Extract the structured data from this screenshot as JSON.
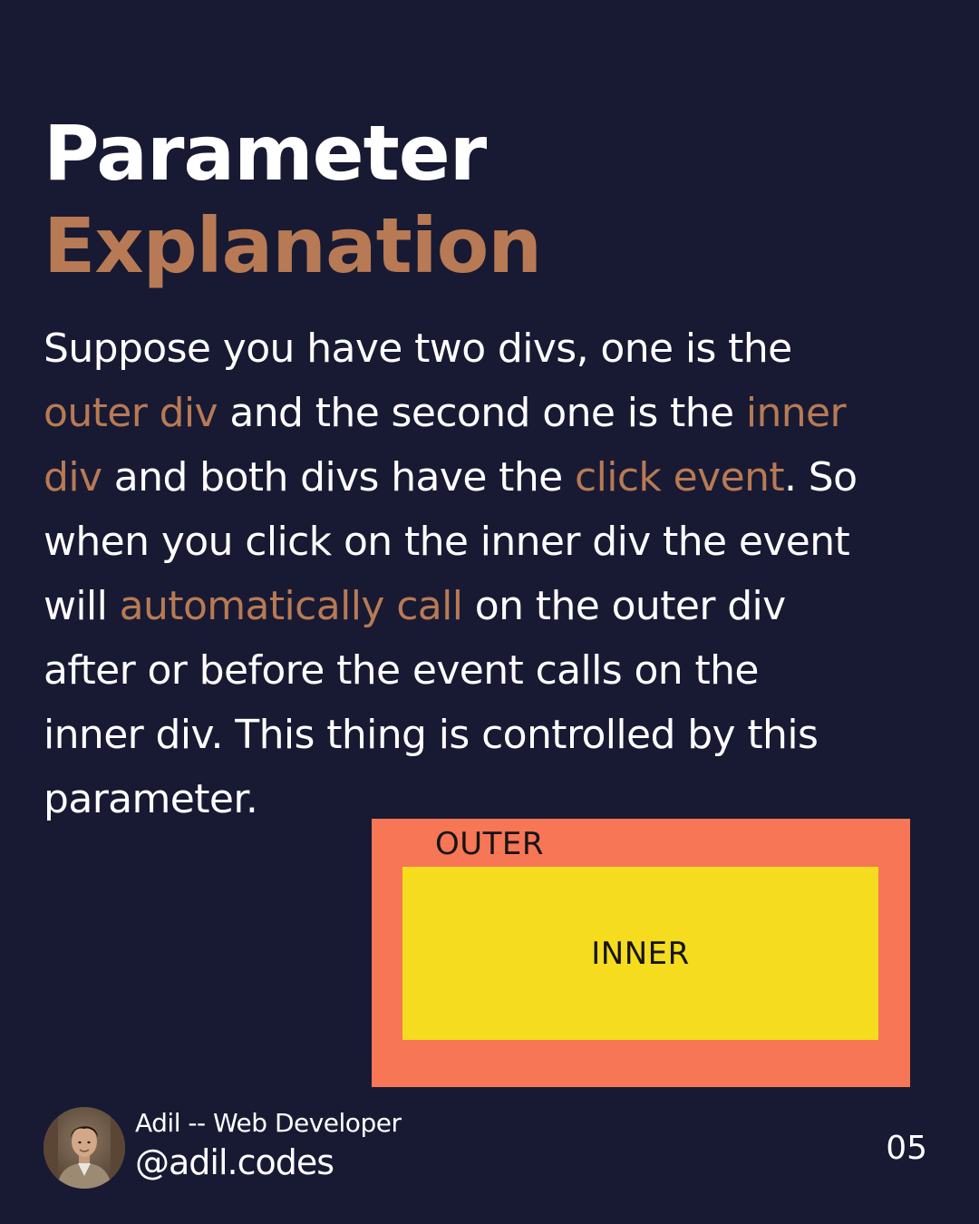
{
  "title": {
    "line1": "Parameter",
    "line2": "Explanation"
  },
  "body": {
    "l1": "Suppose you have two divs, one is the",
    "l2a": "outer div",
    "l2b": " and the second one is the ",
    "l2c": "inner",
    "l3a": "div",
    "l3b": " and both divs have the ",
    "l3c": "click event",
    "l3d": ". So",
    "l4": "when you click on the inner div the event",
    "l5a": "will ",
    "l5b": "automatically call",
    "l5c": " on the outer div",
    "l6": "after or before the event calls on the",
    "l7": "inner div. This thing is controlled by this",
    "l8": "parameter."
  },
  "diagram": {
    "outer_label": "OUTER",
    "inner_label": "INNER",
    "outer_color": "#f77656",
    "inner_color": "#f5dc1e"
  },
  "footer": {
    "author": "Adil -- Web Developer",
    "handle": "@adil.codes",
    "page": "05"
  },
  "colors": {
    "background": "#181a33",
    "accent": "#b87a54",
    "text": "#ffffff"
  }
}
